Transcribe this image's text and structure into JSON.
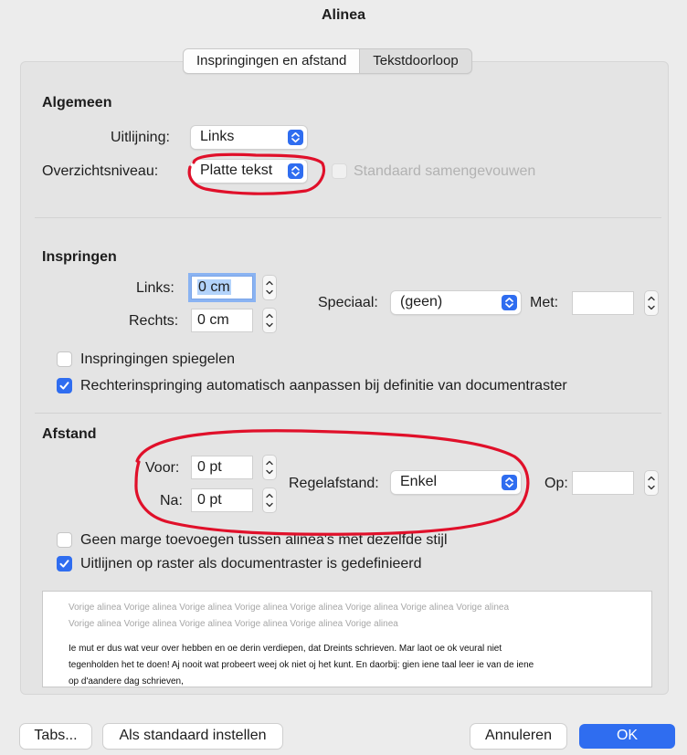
{
  "window": {
    "title": "Alinea"
  },
  "tabs": [
    {
      "label": "Inspringingen en afstand",
      "active": true
    },
    {
      "label": "Tekstdoorloop",
      "active": false
    }
  ],
  "algemeen": {
    "title": "Algemeen",
    "alignment_label": "Uitlijning:",
    "alignment_value": "Links",
    "outline_label": "Overzichtsniveau:",
    "outline_value": "Platte tekst",
    "collapsed_label": "Standaard samengevouwen",
    "collapsed_checked": false,
    "collapsed_enabled": false
  },
  "inspringen": {
    "title": "Inspringen",
    "left_label": "Links:",
    "left_value": "0 cm",
    "right_label": "Rechts:",
    "right_value": "0 cm",
    "special_label": "Speciaal:",
    "special_value": "(geen)",
    "by_label": "Met:",
    "by_value": "",
    "mirror_label": "Inspringingen spiegelen",
    "mirror_checked": false,
    "auto_adjust_label": "Rechterinspringing automatisch aanpassen bij definitie van documentraster",
    "auto_adjust_checked": true
  },
  "afstand": {
    "title": "Afstand",
    "before_label": "Voor:",
    "before_value": "0 pt",
    "after_label": "Na:",
    "after_value": "0 pt",
    "line_spacing_label": "Regelafstand:",
    "line_spacing_value": "Enkel",
    "at_label": "Op:",
    "at_value": "",
    "no_space_label": "Geen marge toevoegen tussen alinea's met dezelfde stijl",
    "no_space_checked": false,
    "snap_grid_label": "Uitlijnen op raster als documentraster is gedefinieerd",
    "snap_grid_checked": true
  },
  "preview": {
    "previous_line_1": "Vorige alinea Vorige alinea Vorige alinea Vorige alinea Vorige alinea Vorige alinea Vorige alinea Vorige alinea",
    "previous_line_2": "Vorige alinea Vorige alinea Vorige alinea Vorige alinea Vorige alinea Vorige alinea",
    "text_line_1": "Ie mut er dus wat veur over hebben en oe derin verdiepen, dat Dreints schrieven. Mar laot oe ok veural niet",
    "text_line_2": "tegenholden het te doen! Aj nooit wat probeert weej ok niet oj het kunt. En daorbij: gien iene taal leer ie van de iene",
    "text_line_3": "op d'aandere dag schrieven,"
  },
  "buttons": {
    "tabs": "Tabs...",
    "set_default": "Als standaard instellen",
    "cancel": "Annuleren",
    "ok": "OK"
  },
  "colors": {
    "accent": "#2f6df0",
    "annotation": "#e0102a"
  }
}
